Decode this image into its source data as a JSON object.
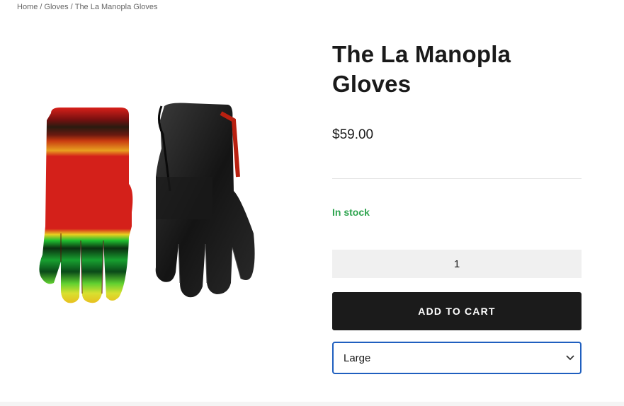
{
  "breadcrumb": {
    "home": "Home",
    "category": "Gloves",
    "current": "The La Manopla Gloves",
    "separator": "/"
  },
  "product": {
    "title": "The La Manopla Gloves",
    "price": "$59.00",
    "stock_status": "In stock",
    "quantity": "1",
    "add_to_cart_label": "ADD TO CART",
    "size_selected": "Large"
  },
  "colors": {
    "stock": "#2ea44f",
    "button_bg": "#1b1b1b",
    "select_border": "#1f5fbf"
  }
}
